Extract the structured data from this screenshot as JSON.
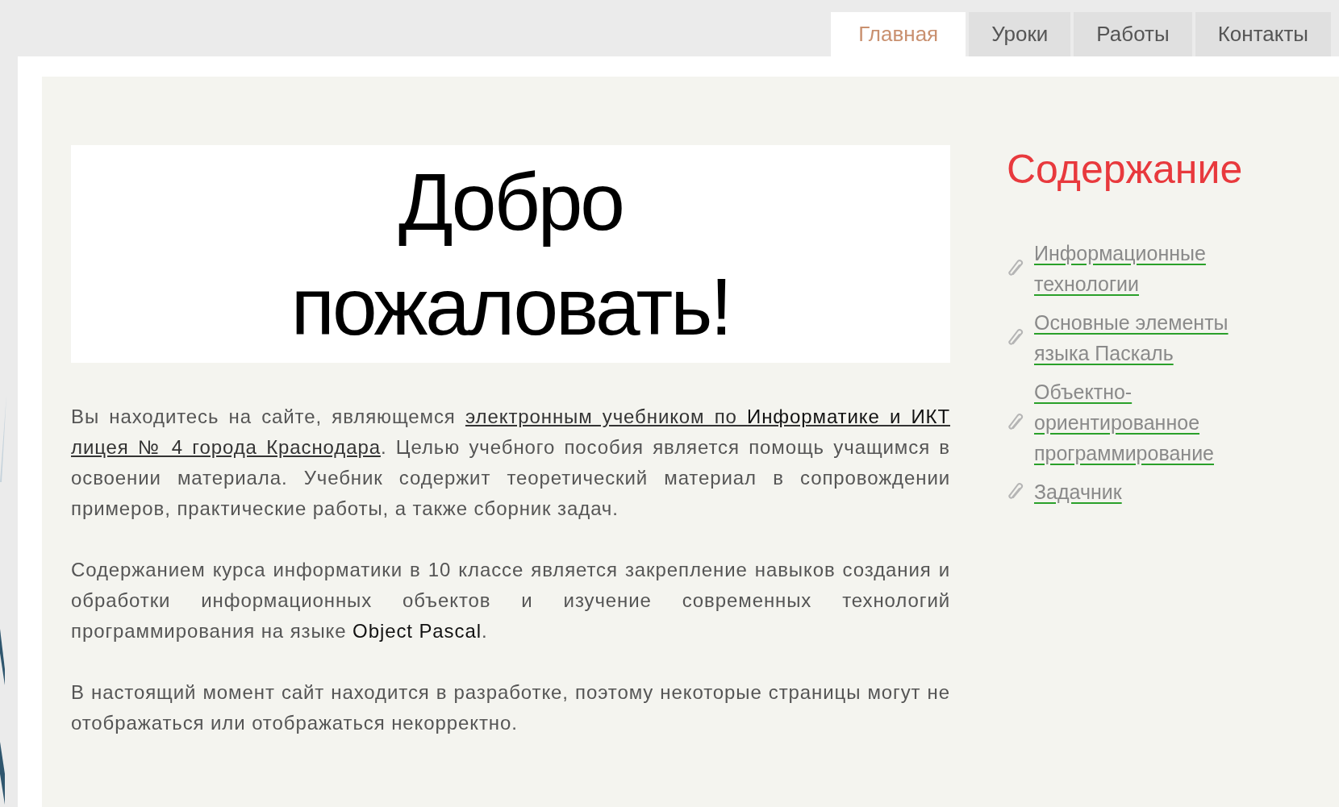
{
  "tabs": [
    {
      "label": "Главная",
      "selected": true
    },
    {
      "label": "Уроки",
      "selected": false
    },
    {
      "label": "Работы",
      "selected": false
    },
    {
      "label": "Контакты",
      "selected": false
    }
  ],
  "welcome": {
    "title": "Добро пожаловать!"
  },
  "paragraphs": [
    {
      "parts": [
        {
          "kind": "text",
          "text": "Вы находитесь на сайте, являющемся "
        },
        {
          "kind": "link",
          "text": "электронным учебником по **Информатике и ИКТ**"
        },
        {
          "kind": "link",
          "text": "лицея № 4 города Краснодара"
        },
        {
          "kind": "text",
          "text": ". Целью учебного пособия является помощь учащимся в освоении материала. Учебник содержит теоретический материал в сопровождении примеров, практические работы, а также сборник задач."
        }
      ]
    },
    {
      "parts": [
        {
          "kind": "text",
          "text": "Содержанием курса информатики в 10 классе является закрепление навыков создания и обработки информационных объектов и изучение современных технологий программирования на языке **Object Pascal**."
        }
      ]
    },
    {
      "parts": [
        {
          "kind": "text",
          "text": "В настоящий момент сайт находится в разработке, поэтому некоторые страницы могут не отображаться или отображаться некорректно."
        }
      ]
    }
  ],
  "sidebar": {
    "title": "Содержание",
    "items": [
      {
        "label": "Информационные технологии"
      },
      {
        "label": "Основные элементы языка Паскаль"
      },
      {
        "label": "Объектно-ориентированное программирование"
      },
      {
        "label": "Задачник"
      }
    ]
  }
}
